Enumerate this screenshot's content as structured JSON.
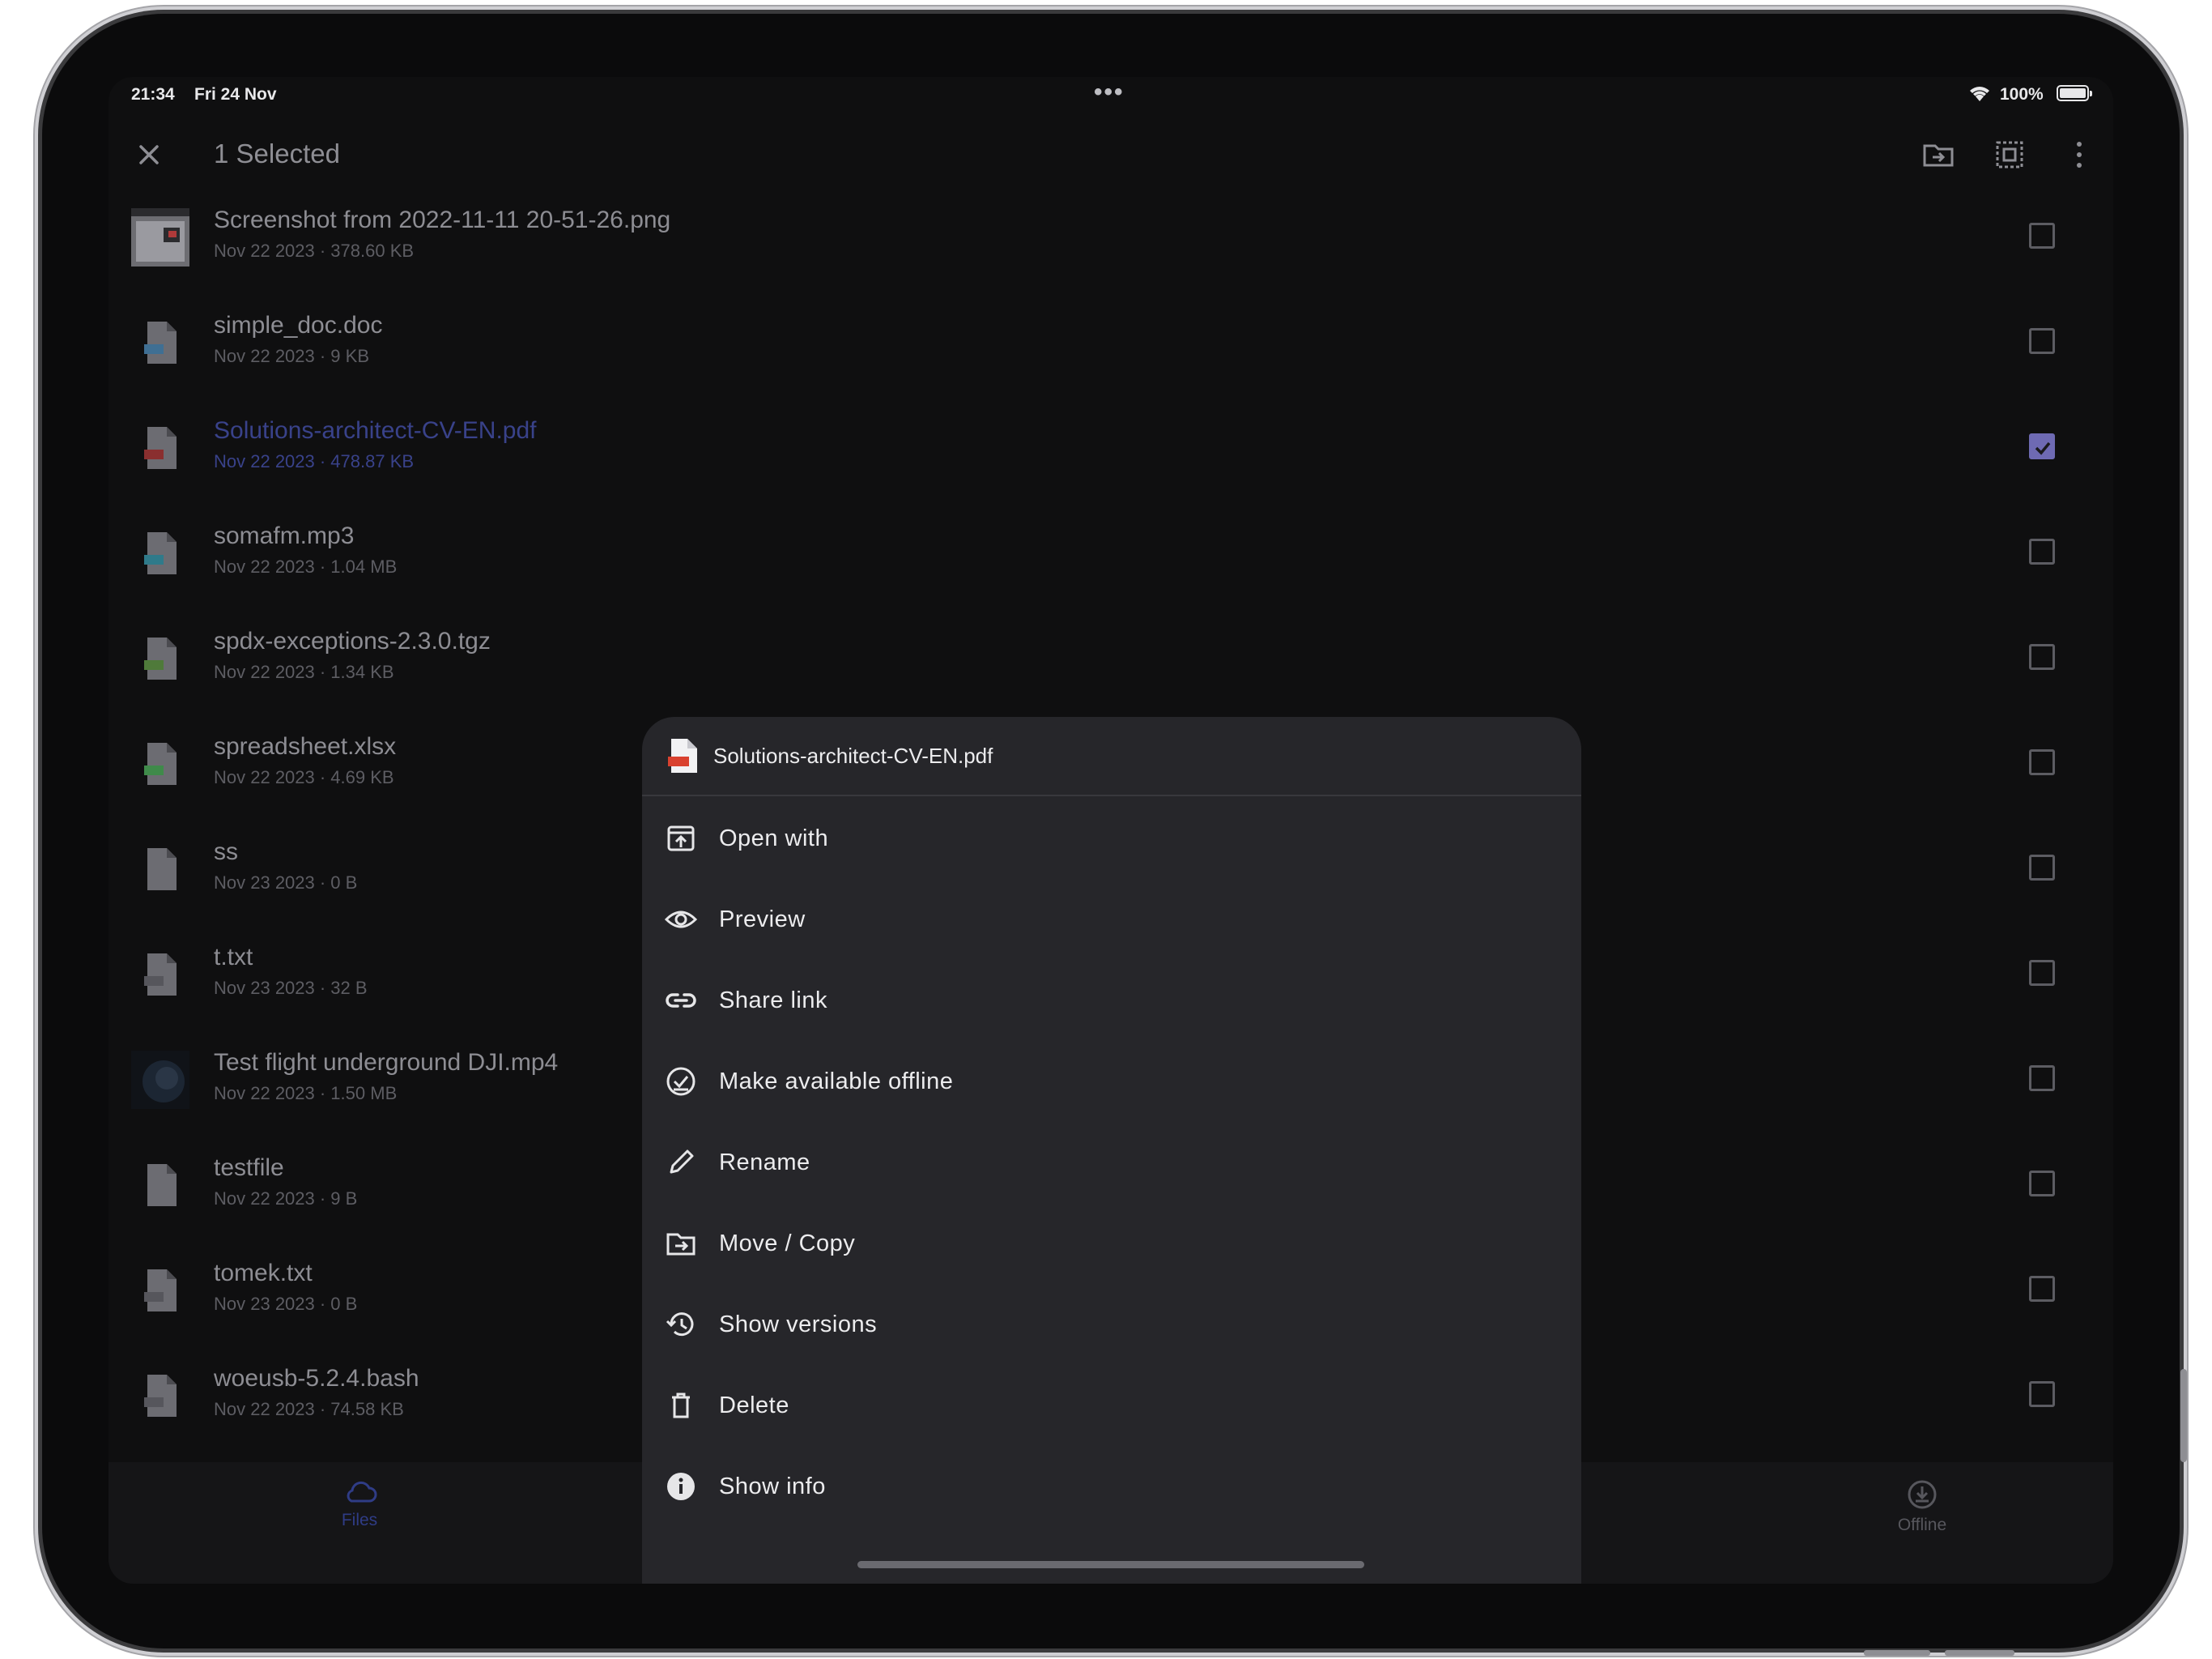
{
  "status": {
    "time": "21:34",
    "date": "Fri 24 Nov",
    "battery": "100%"
  },
  "appbar": {
    "title": "1 Selected"
  },
  "files": [
    {
      "name": "Screenshot from 2022-11-11 20-51-26.png",
      "meta": "Nov 22 2023 · 378.60 KB",
      "icon": "image-thumbnail",
      "selected": false
    },
    {
      "name": "simple_doc.doc",
      "meta": "Nov 22 2023 · 9 KB",
      "icon": "doc-file-icon",
      "selected": false
    },
    {
      "name": "Solutions-architect-CV-EN.pdf",
      "meta": "Nov 22 2023 · 478.87 KB",
      "icon": "pdf-file-icon",
      "selected": true
    },
    {
      "name": "somafm.mp3",
      "meta": "Nov 22 2023 · 1.04 MB",
      "icon": "audio-file-icon",
      "selected": false
    },
    {
      "name": "spdx-exceptions-2.3.0.tgz",
      "meta": "Nov 22 2023 · 1.34 KB",
      "icon": "archive-file-icon",
      "selected": false
    },
    {
      "name": "spreadsheet.xlsx",
      "meta": "Nov 22 2023 · 4.69 KB",
      "icon": "spreadsheet-file-icon",
      "selected": false
    },
    {
      "name": "ss",
      "meta": "Nov 23 2023 · 0 B",
      "icon": "generic-file-icon",
      "selected": false
    },
    {
      "name": "t.txt",
      "meta": "Nov 23 2023 · 32 B",
      "icon": "text-file-icon",
      "selected": false
    },
    {
      "name": "Test flight underground DJI.mp4",
      "meta": "Nov 22 2023 · 1.50 MB",
      "icon": "video-thumbnail",
      "selected": false
    },
    {
      "name": "testfile",
      "meta": "Nov 22 2023 · 9 B",
      "icon": "generic-file-icon",
      "selected": false
    },
    {
      "name": "tomek.txt",
      "meta": "Nov 23 2023 · 0 B",
      "icon": "text-file-icon",
      "selected": false
    },
    {
      "name": "woeusb-5.2.4.bash",
      "meta": "Nov 22 2023 · 74.58 KB",
      "icon": "text-file-icon",
      "selected": false
    }
  ],
  "tabs": {
    "files": "Files",
    "offline": "Offline"
  },
  "sheet": {
    "file_name": "Solutions-architect-CV-EN.pdf",
    "items": [
      {
        "label": "Open with",
        "icon": "open-with-icon"
      },
      {
        "label": "Preview",
        "icon": "eye-icon"
      },
      {
        "label": "Share link",
        "icon": "link-icon"
      },
      {
        "label": "Make available offline",
        "icon": "offline-check-icon"
      },
      {
        "label": "Rename",
        "icon": "pencil-icon"
      },
      {
        "label": "Move / Copy",
        "icon": "folder-move-icon"
      },
      {
        "label": "Show versions",
        "icon": "history-icon"
      },
      {
        "label": "Delete",
        "icon": "trash-icon"
      },
      {
        "label": "Show info",
        "icon": "info-icon"
      }
    ]
  },
  "colors": {
    "accent": "#6e6ab3",
    "selected_text": "#39428a",
    "sheet_bg": "#26262a",
    "screen_bg": "#0f0f10"
  }
}
